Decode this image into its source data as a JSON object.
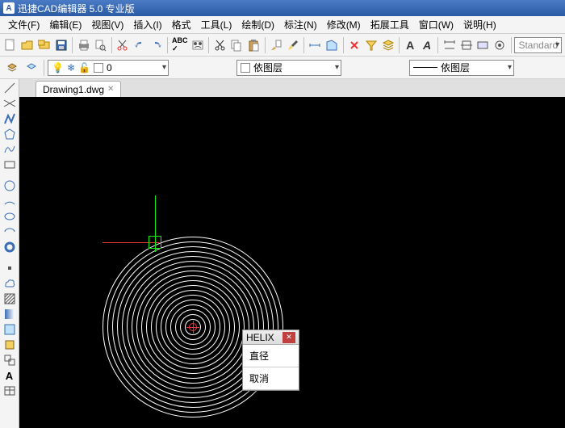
{
  "title": "迅捷CAD编辑器 5.0 专业版",
  "menu": {
    "file": "文件(F)",
    "edit": "编辑(E)",
    "view": "视图(V)",
    "insert": "插入(I)",
    "format": "格式",
    "tools": "工具(L)",
    "draw": "绘制(D)",
    "dim": "标注(N)",
    "modify": "修改(M)",
    "ext": "拓展工具",
    "window": "窗口(W)",
    "help": "说明(H)"
  },
  "layer": {
    "current": "0",
    "bylayer": "依图层",
    "style": "Standard"
  },
  "tab": {
    "name": "Drawing1.dwg"
  },
  "popup": {
    "title": "HELIX",
    "diameter": "直径",
    "cancel": "取消"
  }
}
